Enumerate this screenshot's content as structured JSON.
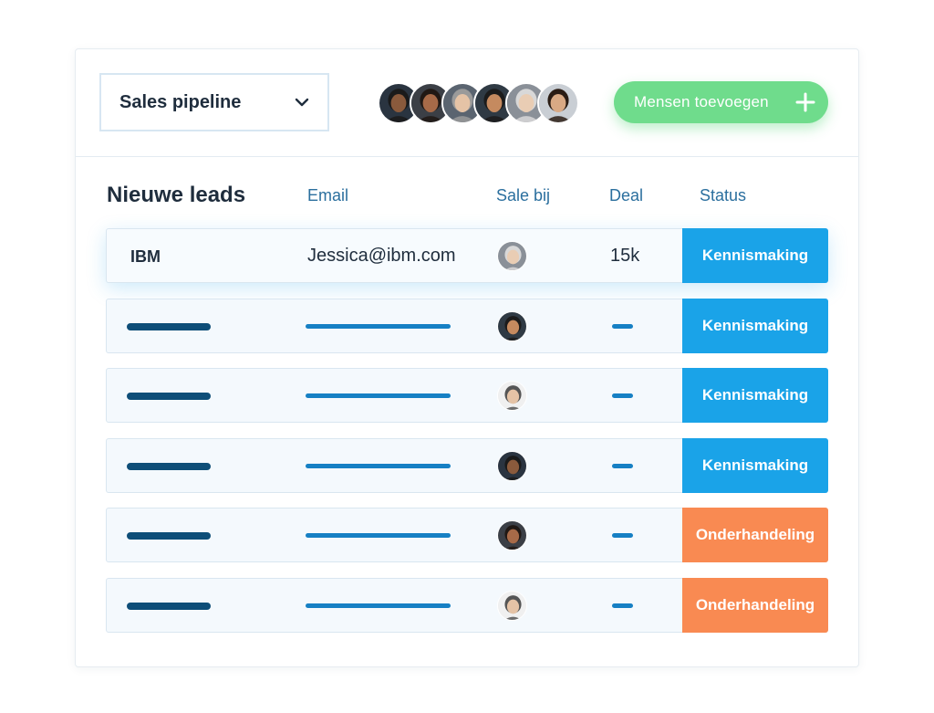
{
  "header": {
    "pipeline_label": "Sales pipeline",
    "add_people_label": "Mensen toevoegen",
    "team_avatars": [
      {
        "bg": "#2a3440",
        "skin": "#8a5a3c",
        "hair": "#1a1a1a"
      },
      {
        "bg": "#3b3f46",
        "skin": "#a76a48",
        "hair": "#201814"
      },
      {
        "bg": "#5a6470",
        "skin": "#e5c3a6",
        "hair": "#9a9a9a"
      },
      {
        "bg": "#2f3a44",
        "skin": "#c58a5f",
        "hair": "#1b1b1b"
      },
      {
        "bg": "#8a9098",
        "skin": "#e9cdb4",
        "hair": "#d8d8d8"
      },
      {
        "bg": "#c9ced4",
        "skin": "#d9a984",
        "hair": "#2a1c14"
      }
    ]
  },
  "table": {
    "title": "Nieuwe leads",
    "columns": {
      "email": "Email",
      "sale_bij": "Sale bij",
      "deal": "Deal",
      "status": "Status"
    },
    "rows": [
      {
        "company": "IBM",
        "email": "Jessica@ibm.com",
        "deal": "15k",
        "status": "Kennismaking",
        "status_color": "#1aa3e8",
        "avatar": {
          "bg": "#8a9098",
          "skin": "#e9cdb4",
          "hair": "#d8d8d8"
        }
      },
      {
        "company": "",
        "email": "",
        "deal": "",
        "status": "Kennismaking",
        "status_color": "#1aa3e8",
        "avatar": {
          "bg": "#2f3a44",
          "skin": "#c58a5f",
          "hair": "#1b1b1b"
        }
      },
      {
        "company": "",
        "email": "",
        "deal": "",
        "status": "Kennismaking",
        "status_color": "#1aa3e8",
        "avatar": {
          "bg": "#f0f0f0",
          "skin": "#e5c3a6",
          "hair": "#555"
        }
      },
      {
        "company": "",
        "email": "",
        "deal": "",
        "status": "Kennismaking",
        "status_color": "#1aa3e8",
        "avatar": {
          "bg": "#2a3440",
          "skin": "#8a5a3c",
          "hair": "#1a1a1a"
        }
      },
      {
        "company": "",
        "email": "",
        "deal": "",
        "status": "Onderhandeling",
        "status_color": "#f98a52",
        "avatar": {
          "bg": "#3b3f46",
          "skin": "#a76a48",
          "hair": "#201814"
        }
      },
      {
        "company": "",
        "email": "",
        "deal": "",
        "status": "Onderhandeling",
        "status_color": "#f98a52",
        "avatar": {
          "bg": "#f0f0f0",
          "skin": "#e5c3a6",
          "hair": "#555"
        }
      }
    ]
  },
  "colors": {
    "accent_green": "#6fdc8c",
    "status_blue": "#1aa3e8",
    "status_orange": "#f98a52",
    "placeholder_dark": "#0e4e78",
    "placeholder_blue": "#1680c4"
  }
}
